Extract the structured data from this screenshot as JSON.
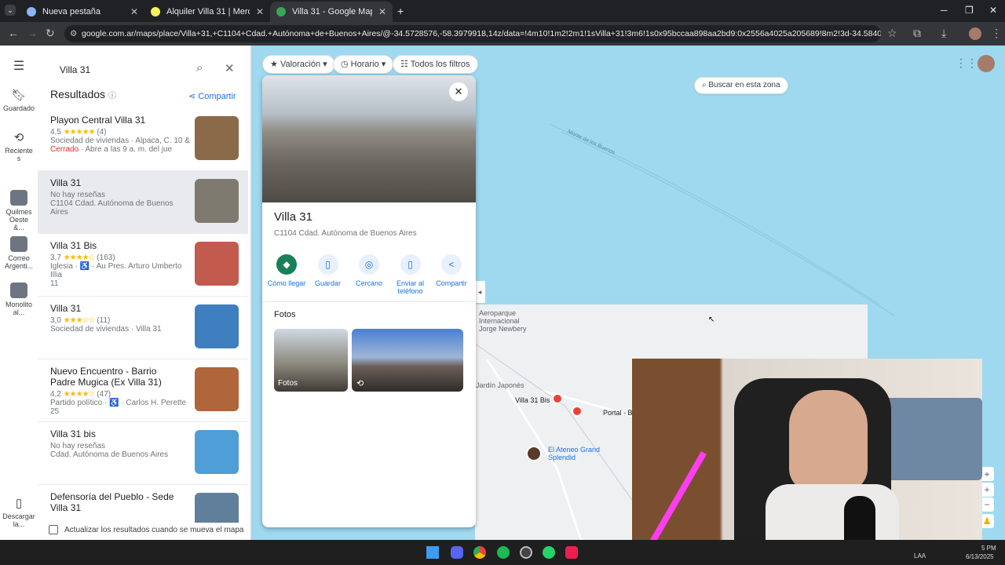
{
  "tabs": [
    {
      "title": "Nueva pestaña",
      "active": false
    },
    {
      "title": "Alquiler Villa 31 | MercadoLibre",
      "active": false
    },
    {
      "title": "Villa 31 - Google Maps",
      "active": true
    }
  ],
  "address": {
    "url": "google.com.ar/maps/place/Villa+31,+C1104+Cdad.+Autónoma+de+Buenos+Aires/@-34.5728576,-58.3979918,14z/data=!4m10!1m2!2m1!1sVilla+31!3m6!1s0x95bccaa898aa2bd9:0x2556a4025a205689!8m2!3d-34.584078!4d-58.3783041!15s..."
  },
  "rail": {
    "saved": "Guardado",
    "recents": "Reciente s",
    "r1": "Quilmes Oeste &...",
    "r2": "Correo Argenti...",
    "r3": "Monolito al...",
    "download": "Descargar la..."
  },
  "search": {
    "value": "Villa 31"
  },
  "results_header": "Resultados",
  "share_label": "Compartir",
  "results": [
    {
      "name": "Playon Central Villa 31",
      "rating": "4,5",
      "stars": "★★★★★",
      "count": "(4)",
      "line1": "Sociedad de viviendas · Alpaca, C. 10 &",
      "status": "Cerrado",
      "status_rest": " · Abre a las 9 a. m. del jue"
    },
    {
      "name": "Villa 31",
      "rating": "",
      "stars": "",
      "count": "",
      "line1": "No hay reseñas",
      "line2": "C1104 Cdad. Autónoma de Buenos Aires"
    },
    {
      "name": "Villa 31 Bis",
      "rating": "3,7",
      "stars": "★★★★☆",
      "count": "(163)",
      "line1": "Iglesia · ♿ · Au Pres. Arturo Umberto Illia",
      "line2": "11"
    },
    {
      "name": "Villa 31",
      "rating": "3,0",
      "stars": "★★★☆☆",
      "count": "(11)",
      "line1": "Sociedad de viviendas · Villa 31"
    },
    {
      "name": "Nuevo Encuentro - Barrio Padre Mugica (Ex Villa 31)",
      "rating": "4,2",
      "stars": "★★★★☆",
      "count": "(47)",
      "line1": "Partido político · ♿ · Carlos H. Perette",
      "line2": "25"
    },
    {
      "name": "Villa 31 bis",
      "rating": "",
      "stars": "",
      "count": "",
      "line1": "No hay reseñas",
      "line2": "Cdad. Autónoma de Buenos Aires"
    },
    {
      "name": "Defensoría del Pueblo - Sede Villa 31",
      "rating": "",
      "stars": "",
      "count": "",
      "line1": ""
    }
  ],
  "update_checkbox": "Actualizar los resultados cuando se mueva el mapa",
  "filters": {
    "valoracion": "Valoración",
    "horario": "Horario",
    "todos": "Todos los filtros"
  },
  "search_zone": "Buscar en esta zona",
  "place": {
    "name": "Villa 31",
    "address": "C1104 Cdad. Autónoma de Buenos Aires",
    "photos_header": "Fotos",
    "photo1": "Fotos",
    "actions": [
      {
        "label": "Cómo llegar",
        "icon": "◆"
      },
      {
        "label": "Guardar",
        "icon": "▯"
      },
      {
        "label": "Cercano",
        "icon": "◎"
      },
      {
        "label": "Enviar al teléfono",
        "icon": "▯"
      },
      {
        "label": "Compartir",
        "icon": "<"
      }
    ]
  },
  "map_labels": {
    "street1": "Monte de los Buenos",
    "airport": "Aeroparque Internacional Jorge Newbery",
    "japones": "Jardín Japonés",
    "villa31bis": "Villa 31 Bis",
    "portal": "Portal - B",
    "ateneo": "El Ateneo Grand Splendid"
  },
  "taskbar": {
    "time": "5 PM",
    "date": "6/13/2025",
    "lang": "LAA"
  }
}
